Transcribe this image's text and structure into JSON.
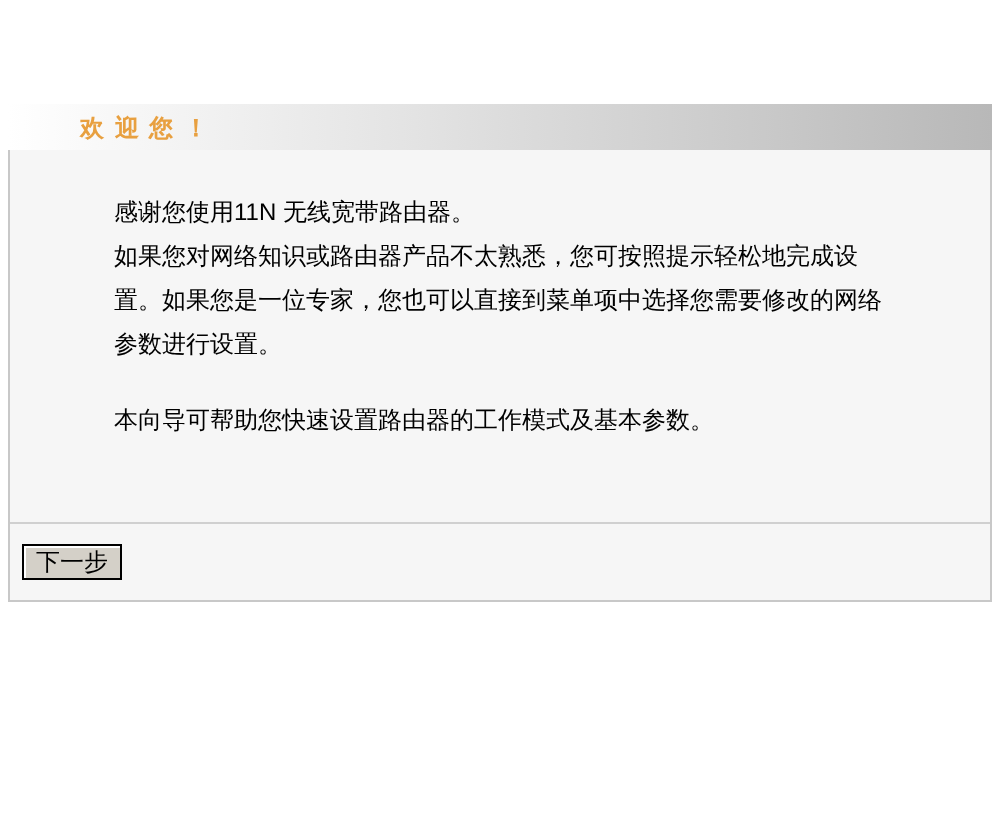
{
  "header": {
    "title": "欢 迎 您 ！"
  },
  "paragraphs": [
    "感谢您使用11N 无线宽带路由器。",
    "如果您对网络知识或路由器产品不太熟悉，您可按照提示轻松地完成设置。如果您是一位专家，您也可以直接到菜单项中选择您需要修改的网络参数进行设置。",
    "本向导可帮助您快速设置路由器的工作模式及基本参数。"
  ],
  "buttons": [
    "下一步"
  ]
}
